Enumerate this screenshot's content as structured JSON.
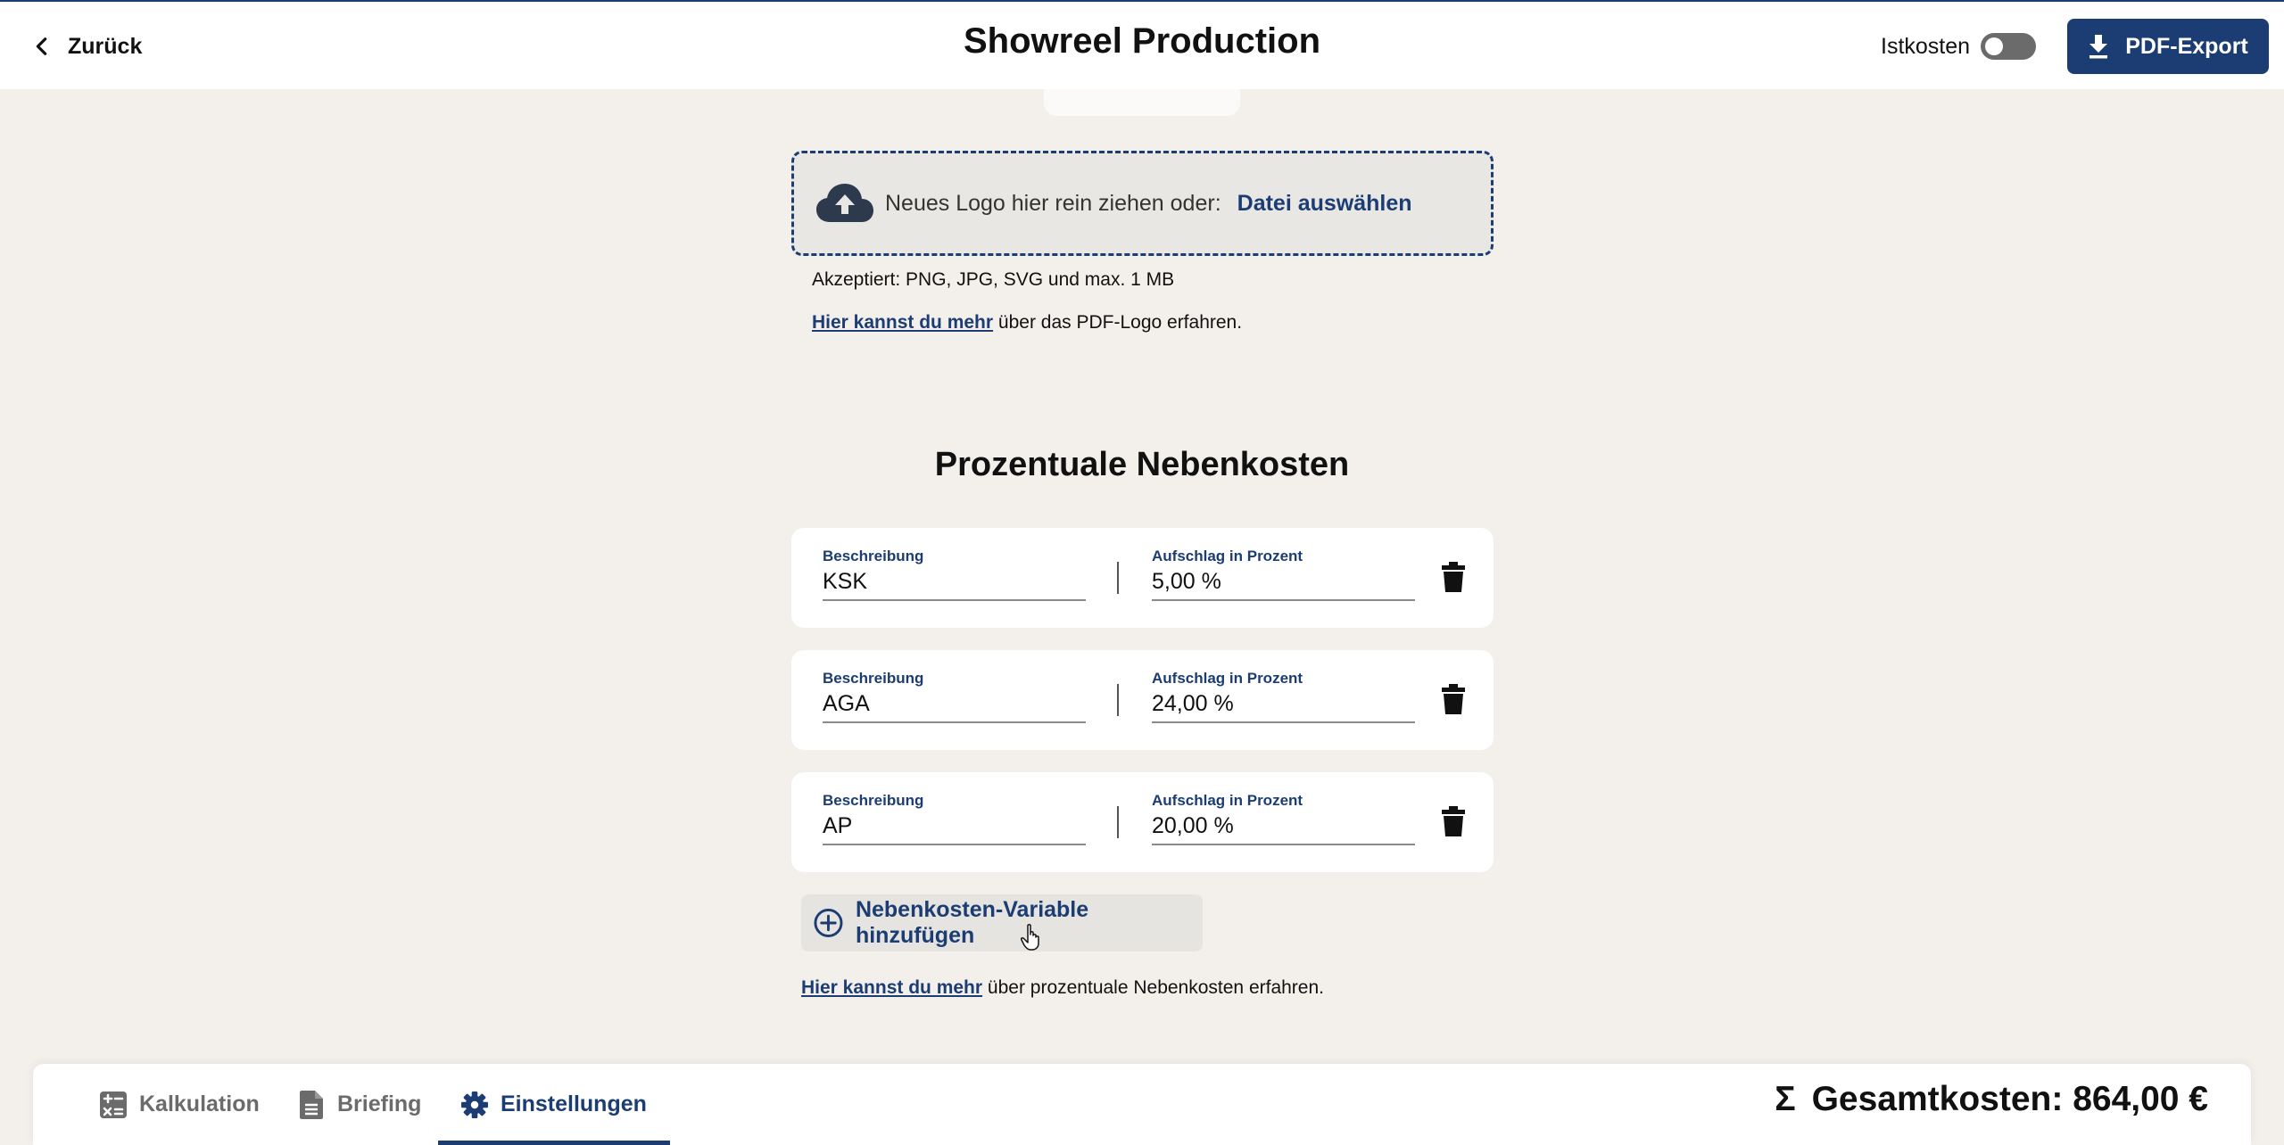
{
  "header": {
    "back_label": "Zurück",
    "title": "Showreel Production",
    "istkosten_label": "Istkosten",
    "istkosten_enabled": false,
    "pdf_export_label": "PDF-Export"
  },
  "logo_upload": {
    "drop_text": "Neues Logo hier rein ziehen oder:",
    "file_link": "Datei auswählen",
    "accepted": "Akzeptiert: PNG, JPG, SVG und max. 1 MB",
    "info_link": "Hier kannst du mehr",
    "info_rest": "über das PDF-Logo erfahren."
  },
  "nebenkosten": {
    "title": "Prozentuale Nebenkosten",
    "desc_label": "Beschreibung",
    "pct_label": "Aufschlag in Prozent",
    "rows": [
      {
        "desc": "KSK",
        "pct": "5,00 %"
      },
      {
        "desc": "AGA",
        "pct": "24,00 %"
      },
      {
        "desc": "AP",
        "pct": "20,00 %"
      }
    ],
    "add_label": "Nebenkosten-Variable hinzufügen",
    "info_link": "Hier kannst du mehr",
    "info_rest": "über prozentuale Nebenkosten erfahren."
  },
  "bottom_nav": {
    "tabs": [
      {
        "label": "Kalkulation",
        "icon": "calculator-icon",
        "active": false
      },
      {
        "label": "Briefing",
        "icon": "document-icon",
        "active": false
      },
      {
        "label": "Einstellungen",
        "icon": "gear-icon",
        "active": true
      }
    ],
    "total_label": "Gesamtkosten: 864,00 €"
  },
  "colors": {
    "primary": "#1c3d73",
    "background": "#f3efea"
  }
}
